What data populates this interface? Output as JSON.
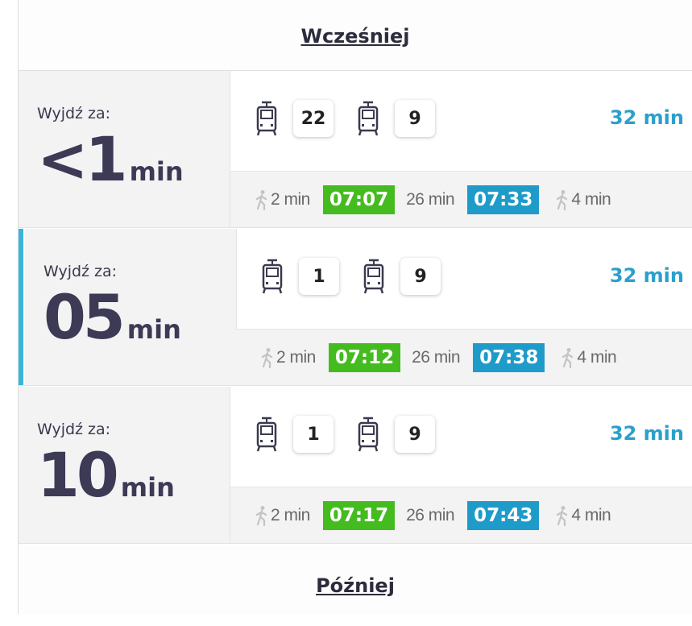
{
  "nav": {
    "earlier": "Wcześniej",
    "later": "Później"
  },
  "trips": [
    {
      "leave_label": "Wyjdź za:",
      "countdown": "<1",
      "countdown_unit": "min",
      "lines": [
        "22",
        "9"
      ],
      "duration": "32 min",
      "walk_start": "2 min",
      "departure": "07:07",
      "ride": "26 min",
      "arrival": "07:33",
      "walk_end": "4 min",
      "selected": false
    },
    {
      "leave_label": "Wyjdź za:",
      "countdown": "05",
      "countdown_unit": "min",
      "lines": [
        "1",
        "9"
      ],
      "duration": "32 min",
      "walk_start": "2 min",
      "departure": "07:12",
      "ride": "26 min",
      "arrival": "07:38",
      "walk_end": "4 min",
      "selected": true
    },
    {
      "leave_label": "Wyjdź za:",
      "countdown": "10",
      "countdown_unit": "min",
      "lines": [
        "1",
        "9"
      ],
      "duration": "32 min",
      "walk_start": "2 min",
      "departure": "07:17",
      "ride": "26 min",
      "arrival": "07:43",
      "walk_end": "4 min",
      "selected": false
    }
  ],
  "icons": {
    "vehicle": "tram-icon",
    "walk": "walking-person-icon"
  },
  "colors": {
    "departure_badge": "#44bb1f",
    "arrival_badge": "#1f9bc9",
    "duration_text": "#2ba0cc",
    "selected_accent": "#39b5d9"
  }
}
